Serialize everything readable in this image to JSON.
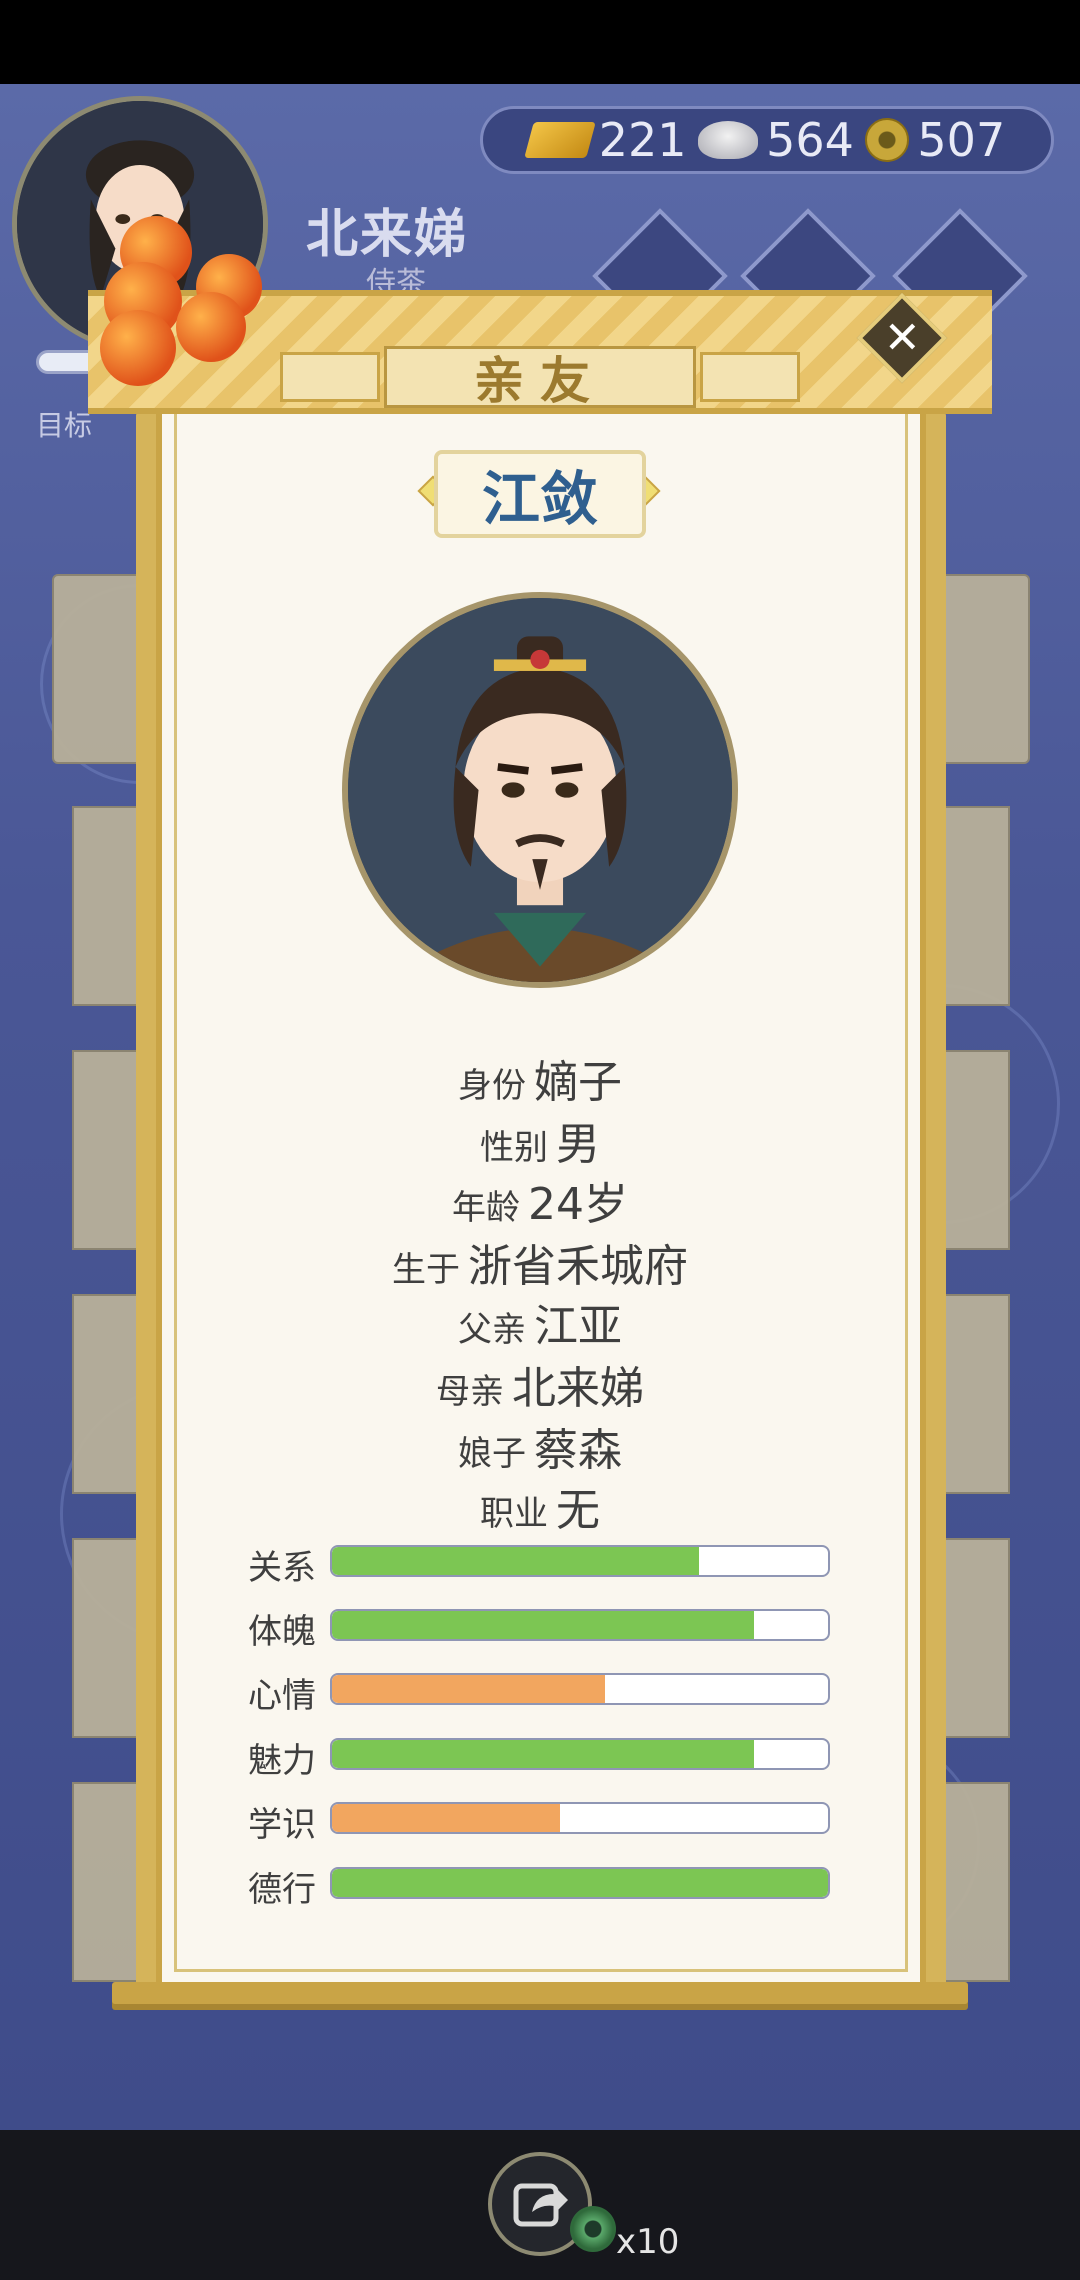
{
  "player": {
    "name": "北来娣",
    "title": "侍茶",
    "goal_label": "目标"
  },
  "currency": {
    "gold": "221",
    "silver": "564",
    "copper": "507"
  },
  "modal": {
    "title": "亲友",
    "close_symbol": "✕",
    "character_name": "江敛",
    "info": [
      {
        "key": "身份",
        "value": "嫡子"
      },
      {
        "key": "性别",
        "value": "男"
      },
      {
        "key": "年龄",
        "value": "24岁"
      },
      {
        "key": "生于",
        "value": "浙省禾城府"
      },
      {
        "key": "父亲",
        "value": "江亚"
      },
      {
        "key": "母亲",
        "value": "北来娣"
      },
      {
        "key": "娘子",
        "value": "蔡森"
      },
      {
        "key": "职业",
        "value": "无"
      }
    ],
    "stats": [
      {
        "label": "关系",
        "level": 0.74,
        "color": "#7cc653"
      },
      {
        "label": "体魄",
        "level": 0.85,
        "color": "#7cc653"
      },
      {
        "label": "心情",
        "level": 0.55,
        "color": "#f2a65f"
      },
      {
        "label": "魅力",
        "level": 0.85,
        "color": "#7cc653"
      },
      {
        "label": "学识",
        "level": 0.46,
        "color": "#f2a65f"
      },
      {
        "label": "德行",
        "level": 1.0,
        "color": "#7cc653"
      }
    ]
  },
  "bottom": {
    "ad_multiplier": "x10"
  }
}
